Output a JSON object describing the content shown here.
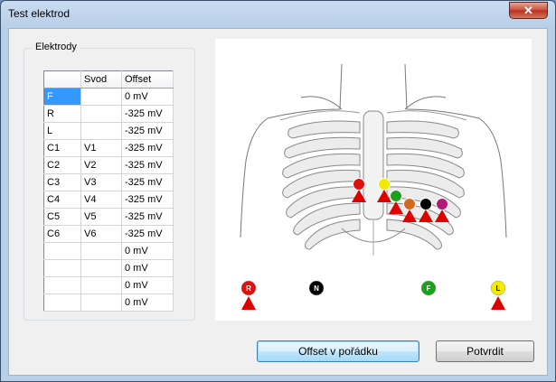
{
  "window": {
    "title": "Test elektrod",
    "close_label": "✕"
  },
  "group": {
    "label": "Elektrody"
  },
  "table": {
    "headers": [
      "",
      "Svod",
      "Offset"
    ],
    "rows": [
      [
        "F",
        "",
        "0 mV"
      ],
      [
        "R",
        "",
        "-325 mV"
      ],
      [
        "L",
        "",
        "-325 mV"
      ],
      [
        "C1",
        "V1",
        "-325 mV"
      ],
      [
        "C2",
        "V2",
        "-325 mV"
      ],
      [
        "C3",
        "V3",
        "-325 mV"
      ],
      [
        "C4",
        "V4",
        "-325 mV"
      ],
      [
        "C5",
        "V5",
        "-325 mV"
      ],
      [
        "C6",
        "V6",
        "-325 mV"
      ],
      [
        "",
        "",
        "0 mV"
      ],
      [
        "",
        "",
        "0 mV"
      ],
      [
        "",
        "",
        "0 mV"
      ],
      [
        "",
        "",
        "0 mV"
      ]
    ]
  },
  "limb_electrodes": [
    {
      "label": "R",
      "color": "#e01010",
      "text_color": "#ffffff",
      "warning": true
    },
    {
      "label": "N",
      "color": "#000000",
      "text_color": "#ffffff",
      "warning": false
    },
    {
      "label": "F",
      "color": "#1aa31a",
      "text_color": "#ffffff",
      "warning": false
    },
    {
      "label": "L",
      "color": "#f2ea00",
      "text_color": "#000000",
      "warning": true
    }
  ],
  "chest_electrodes": [
    {
      "name": "C1",
      "color": "#e01010"
    },
    {
      "name": "C2",
      "color": "#f2ea00"
    },
    {
      "name": "C3",
      "color": "#1aa31a"
    },
    {
      "name": "C4",
      "color": "#d2691e"
    },
    {
      "name": "C5",
      "color": "#000000"
    },
    {
      "name": "C6",
      "color": "#b0197a"
    }
  ],
  "warning_color": "#e00000",
  "buttons": {
    "offset_ok": "Offset v pořádku",
    "confirm": "Potvrdit"
  }
}
